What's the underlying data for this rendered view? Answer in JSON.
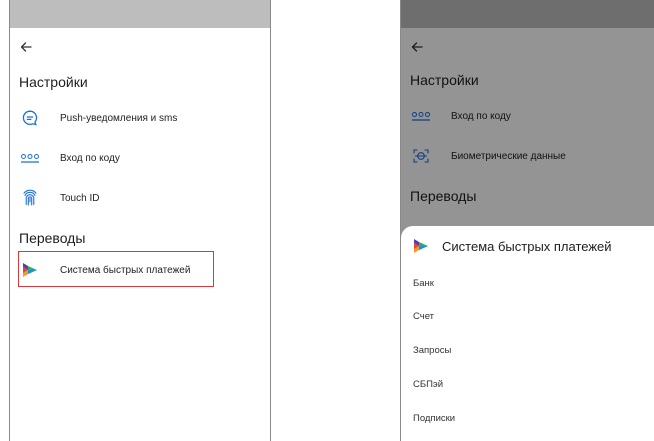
{
  "left_screen": {
    "back_icon": "arrow-left-icon",
    "settings_title": "Настройки",
    "settings_items": [
      {
        "icon": "chat-bubble-icon",
        "label": "Push-уведомления и sms"
      },
      {
        "icon": "dots-code-icon",
        "label": "Вход по коду"
      },
      {
        "icon": "fingerprint-icon",
        "label": "Touch ID"
      }
    ],
    "transfers_title": "Переводы",
    "transfers_items": [
      {
        "icon": "sbp-logo-icon",
        "label": "Система быстрых платежей",
        "highlighted": true
      }
    ],
    "highlight_color": "#d9383c"
  },
  "right_screen": {
    "back_icon": "arrow-left-icon",
    "settings_title": "Настройки",
    "settings_items": [
      {
        "icon": "dots-code-icon",
        "label": "Вход по коду"
      },
      {
        "icon": "face-scan-icon",
        "label": "Биометрические данные"
      }
    ],
    "transfers_title": "Переводы",
    "sheet": {
      "title": "Система быстрых платежей",
      "icon": "sbp-logo-icon",
      "options": [
        "Банк",
        "Счет",
        "Запросы",
        "СБПэй",
        "Подписки"
      ]
    }
  },
  "colors": {
    "accent_blue": "#1e6fd9",
    "status_bar": "#bdbdbd",
    "sbp_green": "#2fb34a",
    "sbp_orange": "#f59a23",
    "sbp_purple": "#5b3ba8",
    "sbp_blue": "#1f8fe0"
  }
}
